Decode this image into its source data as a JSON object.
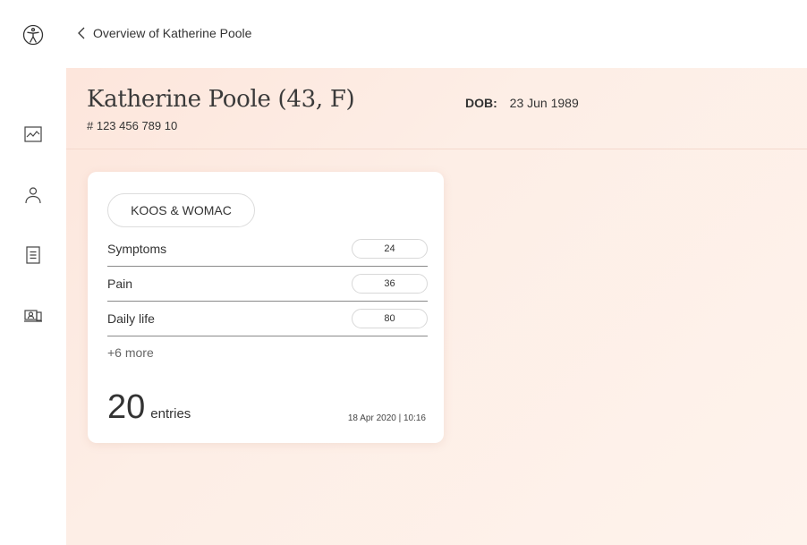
{
  "header": {
    "logo_icon": "accessibility-person-icon",
    "back_icon": "chevron-left-icon",
    "breadcrumb": "Overview of Katherine Poole"
  },
  "sidebar": {
    "items": [
      {
        "name": "chart",
        "icon": "line-chart-icon"
      },
      {
        "name": "profile",
        "icon": "user-icon"
      },
      {
        "name": "documents",
        "icon": "document-icon"
      },
      {
        "name": "consultation",
        "icon": "video-consult-icon"
      }
    ]
  },
  "patient": {
    "name": "Katherine Poole (43, F)",
    "id": "# 123 456 789 10",
    "dob_label": "DOB:",
    "dob_value": "23 Jun 1989"
  },
  "card": {
    "chip": "KOOS & WOMAC",
    "rows": [
      {
        "label": "Symptoms",
        "value": "24"
      },
      {
        "label": "Pain",
        "value": "36"
      },
      {
        "label": "Daily life",
        "value": "80"
      }
    ],
    "more": "+6 more",
    "entries_count": "20",
    "entries_label": "entries",
    "timestamp": "18 Apr 2020 | 10:16"
  },
  "colors": {
    "background_gradient_start": "#fde6dc",
    "background_gradient_end": "#fef3ec",
    "card": "#ffffff",
    "text": "#333333"
  }
}
